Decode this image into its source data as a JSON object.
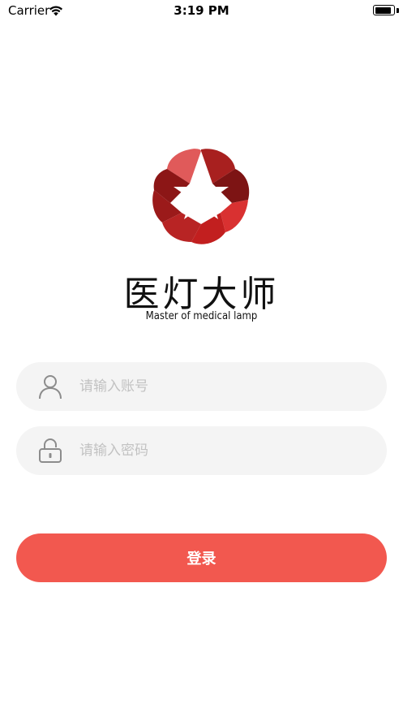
{
  "status_bar": {
    "carrier": "Carrier",
    "time": "3:19 PM",
    "battery_level": 0.95
  },
  "brand": {
    "name": "医灯大师",
    "tagline": "Master of medical lamp",
    "logo_icon": "red-star-flower-logo",
    "colors": [
      "#e05a5a",
      "#a8201f",
      "#7d1414",
      "#d93131",
      "#c21f1f"
    ]
  },
  "login_form": {
    "account_placeholder": "请输入账号",
    "account_value": "",
    "account_icon": "user-icon",
    "password_placeholder": "请输入密码",
    "password_value": "",
    "password_icon": "lock-icon",
    "login_label": "登录",
    "accent_color": "#f2584f"
  }
}
